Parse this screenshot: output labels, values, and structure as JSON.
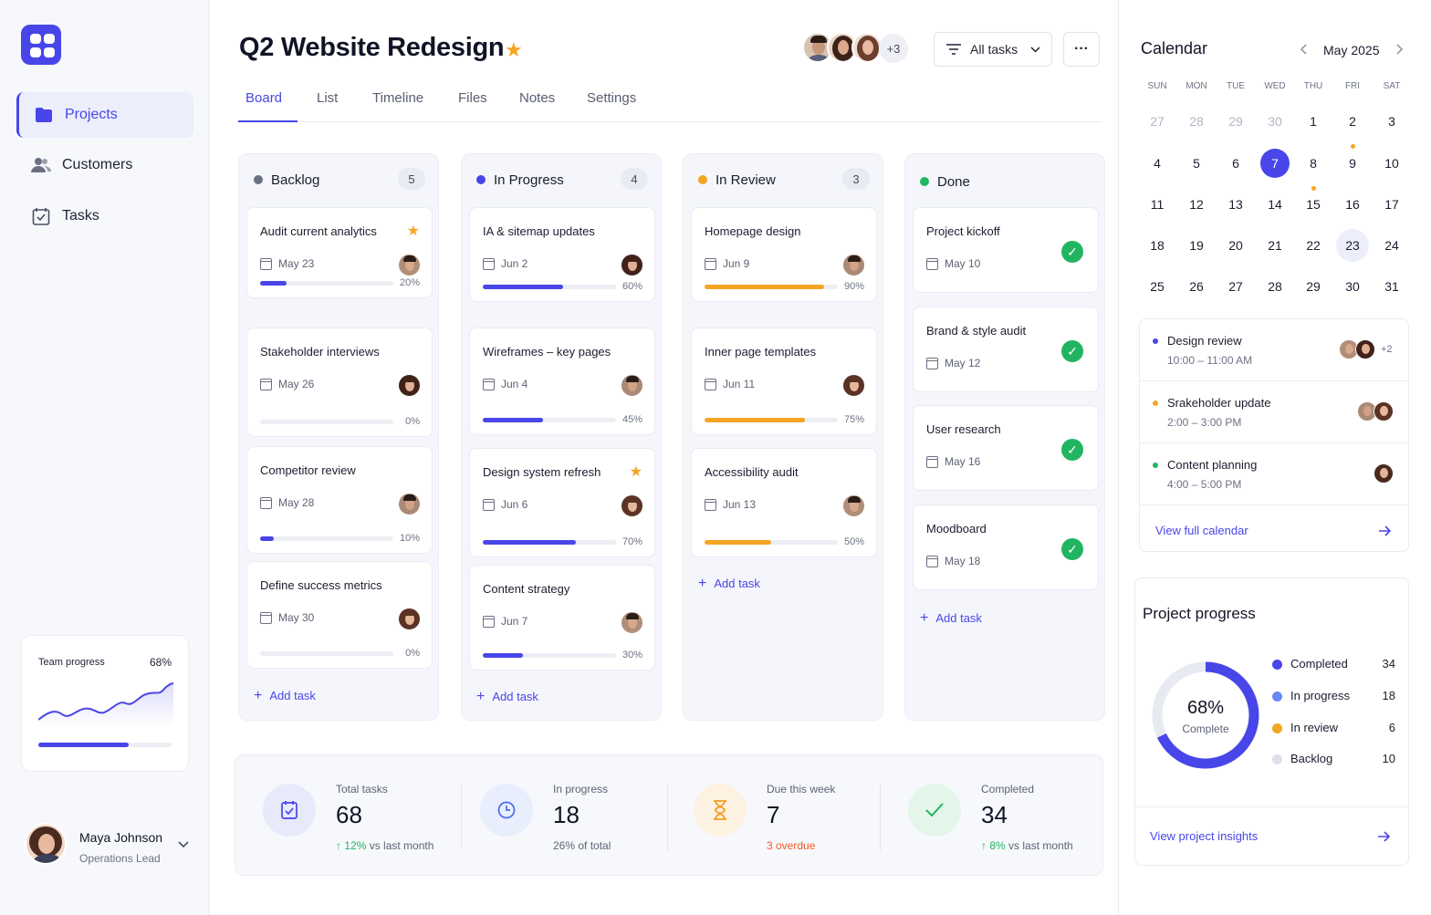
{
  "sidebar": {
    "nav": [
      {
        "label": "Projects",
        "icon": "folder-icon"
      },
      {
        "label": "Customers",
        "icon": "users-icon"
      },
      {
        "label": "Tasks",
        "icon": "task-check-icon"
      }
    ],
    "team_progress": {
      "label": "Team progress",
      "value": "68%",
      "fraction": 0.68
    },
    "user": {
      "name": "Maya Johnson",
      "role": "Operations Lead"
    }
  },
  "header": {
    "title": "Q2 Website Redesign",
    "members_extra": "+3",
    "filter_label": "All tasks",
    "more_label": "···"
  },
  "tabs": [
    "Board",
    "List",
    "Timeline",
    "Files",
    "Notes",
    "Settings"
  ],
  "board": {
    "add_task_label": "Add task",
    "columns": [
      {
        "name": "Backlog",
        "count": "5",
        "color": "#6b6f82",
        "cards": [
          {
            "title": "Audit current analytics",
            "date": "May 23",
            "pct": "20%",
            "progress": 0.2,
            "starred": true
          },
          {
            "title": "Stakeholder interviews",
            "date": "May 26",
            "pct": "0%",
            "progress": 0
          },
          {
            "title": "Competitor review",
            "date": "May 28",
            "pct": "10%",
            "progress": 0.1
          },
          {
            "title": "Define success metrics",
            "date": "May 30",
            "pct": "0%",
            "progress": 0
          }
        ]
      },
      {
        "name": "In Progress",
        "count": "4",
        "color": "#4846e8",
        "cards": [
          {
            "title": "IA & sitemap updates",
            "date": "Jun 2",
            "pct": "60%",
            "progress": 0.6
          },
          {
            "title": "Wireframes – key pages",
            "date": "Jun 4",
            "pct": "45%",
            "progress": 0.45
          },
          {
            "title": "Design system refresh",
            "date": "Jun 6",
            "pct": "70%",
            "progress": 0.7,
            "starred": true
          },
          {
            "title": "Content strategy",
            "date": "Jun 7",
            "pct": "30%",
            "progress": 0.3
          }
        ]
      },
      {
        "name": "In Review",
        "count": "3",
        "color": "#f5a524",
        "cards": [
          {
            "title": "Homepage design",
            "date": "Jun 9",
            "pct": "90%",
            "progress": 0.9
          },
          {
            "title": "Inner page templates",
            "date": "Jun 11",
            "pct": "75%",
            "progress": 0.75
          },
          {
            "title": "Accessibility audit",
            "date": "Jun 13",
            "pct": "50%",
            "progress": 0.5
          }
        ]
      },
      {
        "name": "Done",
        "color": "#22b561",
        "cards": [
          {
            "title": "Project kickoff",
            "date": "May 10"
          },
          {
            "title": "Brand & style audit",
            "date": "May 12"
          },
          {
            "title": "User research",
            "date": "May 16"
          },
          {
            "title": "Moodboard",
            "date": "May 18"
          }
        ]
      }
    ]
  },
  "stats": [
    {
      "label": "Total tasks",
      "value": "68",
      "sub": "12%",
      "sub_rest": "vs last month",
      "icon": "clipboard-check-icon"
    },
    {
      "label": "In progress",
      "value": "18",
      "sub": "",
      "sub_rest": "26% of total",
      "icon": "clock-icon"
    },
    {
      "label": "Due this week",
      "value": "7",
      "sub": "3 overdue",
      "sub_rest": "",
      "icon": "hourglass-icon"
    },
    {
      "label": "Completed",
      "value": "34",
      "sub": "8%",
      "sub_rest": "vs last month",
      "icon": "check-icon"
    }
  ],
  "calendar": {
    "title": "Calendar",
    "month": "May 2025",
    "weekdays": [
      "SUN",
      "MON",
      "TUE",
      "WED",
      "THU",
      "FRI",
      "SAT"
    ],
    "weeks": [
      [
        "27",
        "28",
        "29",
        "30",
        "1",
        "2",
        "3"
      ],
      [
        "4",
        "5",
        "6",
        "7",
        "8",
        "9",
        "10"
      ],
      [
        "11",
        "12",
        "13",
        "14",
        "15",
        "16",
        "17"
      ],
      [
        "18",
        "19",
        "20",
        "21",
        "22",
        "23",
        "24"
      ],
      [
        "25",
        "26",
        "27",
        "28",
        "29",
        "30",
        "31"
      ]
    ],
    "selected": "7",
    "today": "23",
    "events": [
      {
        "title": "Design review",
        "time": "10:00 – 11:00 AM",
        "color": "#4846e8",
        "extra": "+2"
      },
      {
        "title": "Srakeholder update",
        "time": "2:00 – 3:00 PM",
        "color": "#f5a524"
      },
      {
        "title": "Content planning",
        "time": "4:00 – 5:00 PM",
        "color": "#22b561"
      }
    ],
    "view_full": "View full calendar"
  },
  "project_progress": {
    "title": "Project progress",
    "percent": "68%",
    "percent_label": "Complete",
    "legend": [
      {
        "name": "Completed",
        "value": "34",
        "color": "#4846e8"
      },
      {
        "name": "In progress",
        "value": "18",
        "color": "#6b86f5"
      },
      {
        "name": "In review",
        "value": "6",
        "color": "#f5a524"
      },
      {
        "name": "Backlog",
        "value": "10",
        "color": "#dde0ea"
      }
    ],
    "view_insights": "View project insights"
  }
}
